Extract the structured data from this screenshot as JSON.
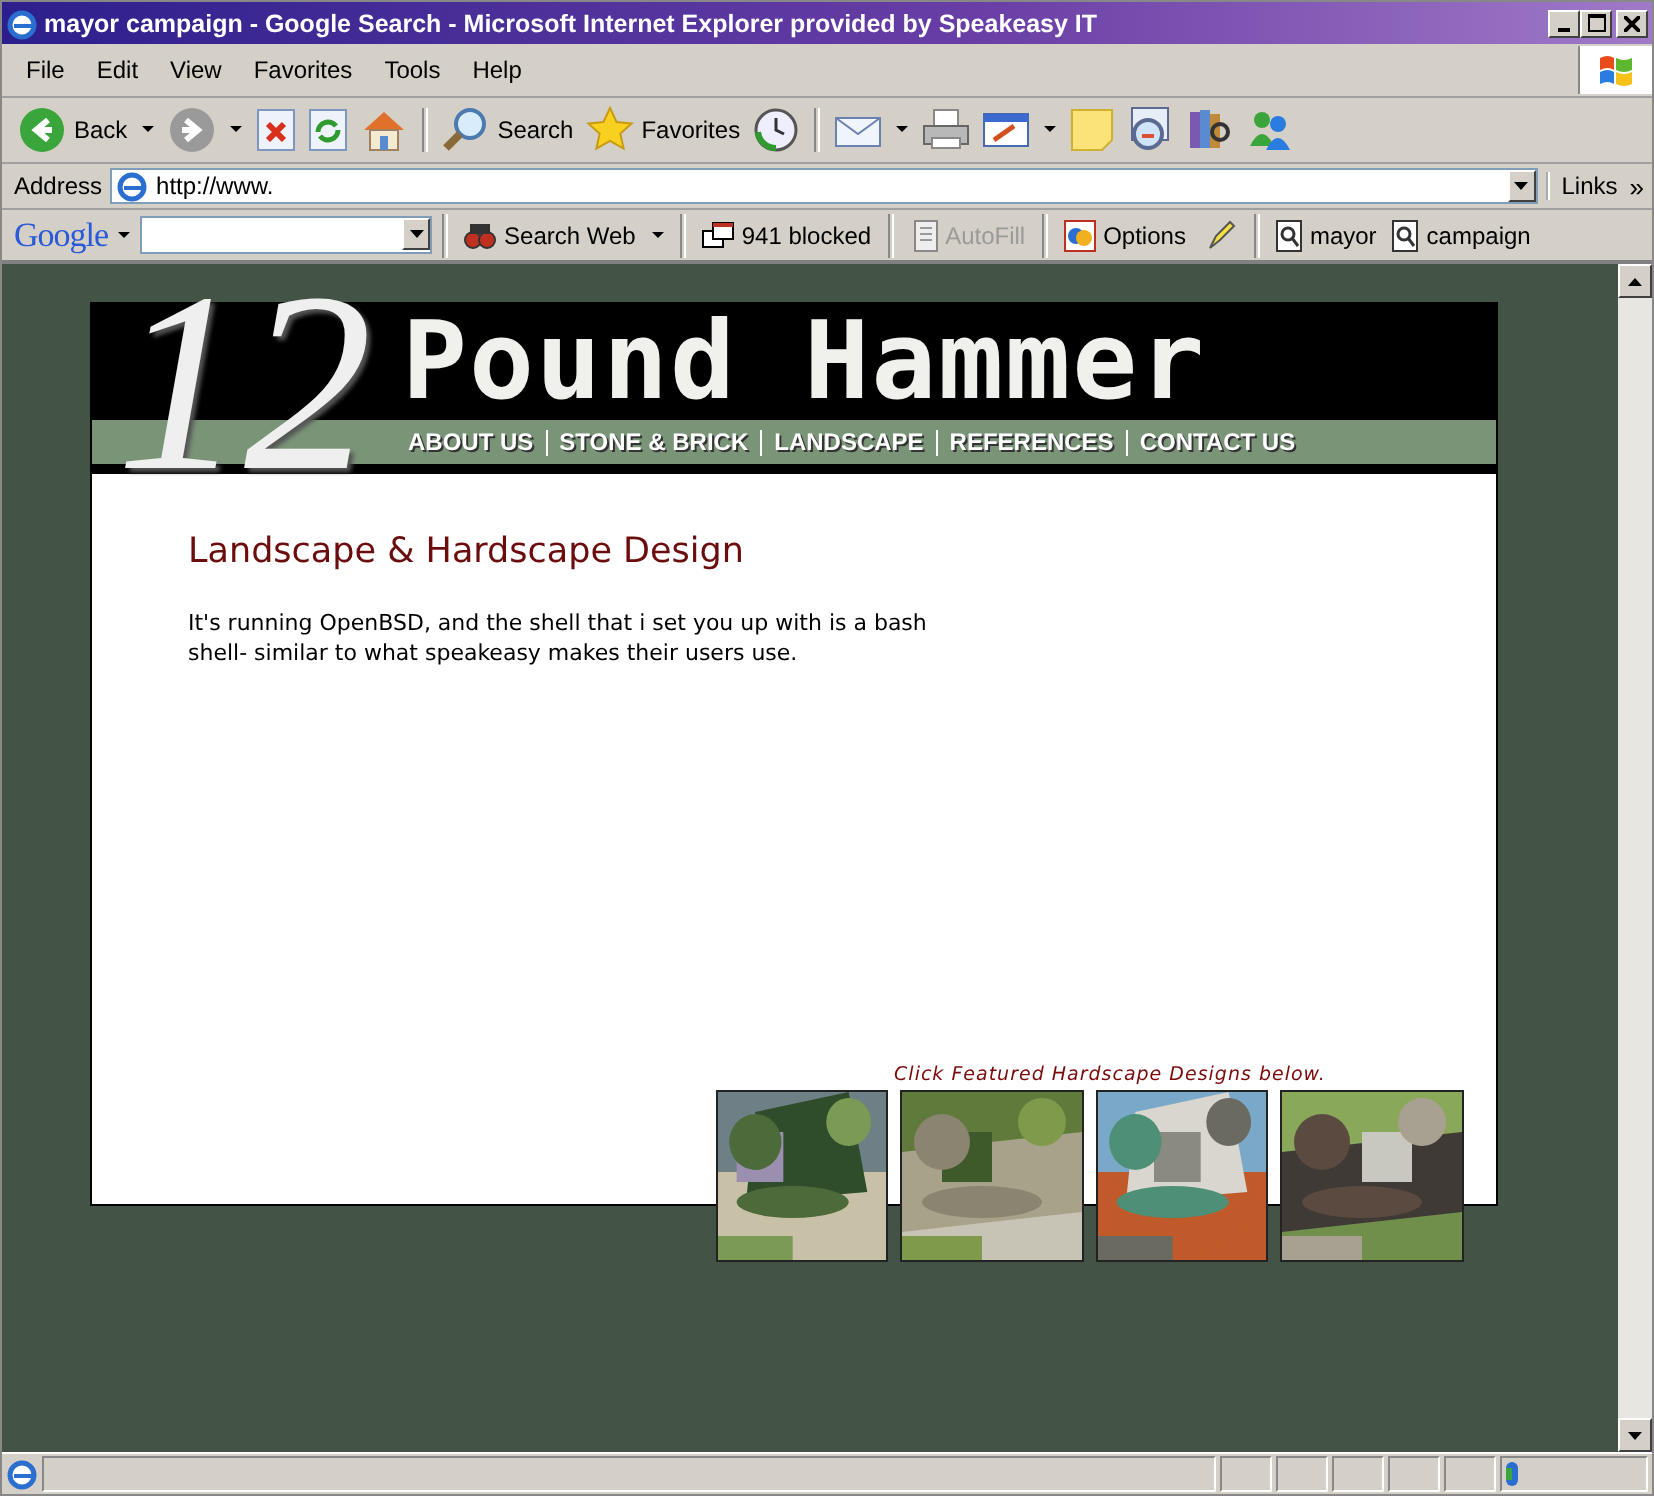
{
  "window": {
    "title": "mayor campaign - Google Search - Microsoft Internet Explorer provided by Speakeasy IT"
  },
  "menu": [
    "File",
    "Edit",
    "View",
    "Favorites",
    "Tools",
    "Help"
  ],
  "toolbar": [
    {
      "kind": "back",
      "label": "Back"
    },
    {
      "kind": "forward"
    },
    {
      "kind": "stop"
    },
    {
      "kind": "refresh"
    },
    {
      "kind": "home"
    },
    {
      "kind": "search",
      "label": "Search"
    },
    {
      "kind": "favorites",
      "label": "Favorites"
    },
    {
      "kind": "history"
    },
    {
      "kind": "mail"
    },
    {
      "kind": "print"
    },
    {
      "kind": "edit"
    },
    {
      "kind": "note"
    },
    {
      "kind": "research"
    },
    {
      "kind": "books"
    },
    {
      "kind": "messenger"
    }
  ],
  "address": {
    "label": "Address",
    "value": "http://www.",
    "links": "Links",
    "chevron": "»"
  },
  "google_bar": {
    "logo": "Google",
    "search_button": "Search Web",
    "blocked": "941 blocked",
    "autofill": {
      "label": "AutoFill",
      "disabled": true
    },
    "options": "Options",
    "terms": [
      "mayor",
      "campaign"
    ]
  },
  "site": {
    "logo_number": "12",
    "logo_text": "Pound Hammer",
    "nav": [
      "ABOUT US",
      "STONE & BRICK",
      "LANDSCAPE",
      "REFERENCES",
      "CONTACT US"
    ],
    "heading": "Landscape & Hardscape Design",
    "body": "It's running OpenBSD, and the shell that i set you up with is a bash shell- similar to what speakeasy makes their users use.",
    "featured_caption": "Click Featured Hardscape Designs below.",
    "photos": [
      {
        "kind": "picture"
      },
      {
        "kind": "picture"
      },
      {
        "kind": "picture"
      },
      {
        "kind": "picture"
      }
    ]
  }
}
